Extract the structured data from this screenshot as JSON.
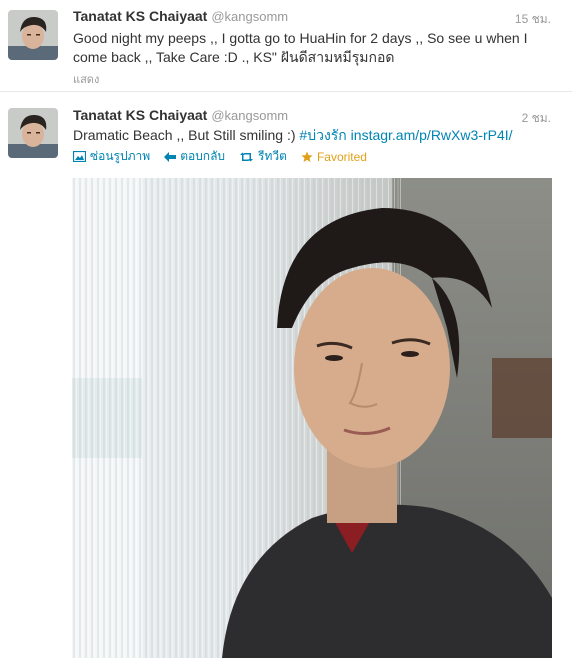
{
  "tweets": [
    {
      "name": "Tanatat KS Chaiyaat",
      "handle": "@kangsomm",
      "time": "15 ชม.",
      "text": "Good night my peeps ,, I gotta go to HuaHin for 2 days ,, So see u when I come back ,, Take Care :D ., KS\" ฝันดีสามหมีรุมกอด",
      "expand_label": "แสดง"
    },
    {
      "name": "Tanatat KS Chaiyaat",
      "handle": "@kangsomm",
      "time": "2 ชม.",
      "text": "Dramatic Beach ,, But Still smiling :) ",
      "hashtag": "#บ่วงรัก",
      "link": "instagr.am/p/RwXw3-rP4I/",
      "actions": {
        "hide_photo": "ซ่อนรูปภาพ",
        "reply": "ตอบกลับ",
        "retweet": "รีทวีต",
        "favorite": "Favorited"
      }
    }
  ],
  "colors": {
    "link": "#0084b4",
    "favorited": "#e0a11a",
    "muted": "#999999"
  }
}
